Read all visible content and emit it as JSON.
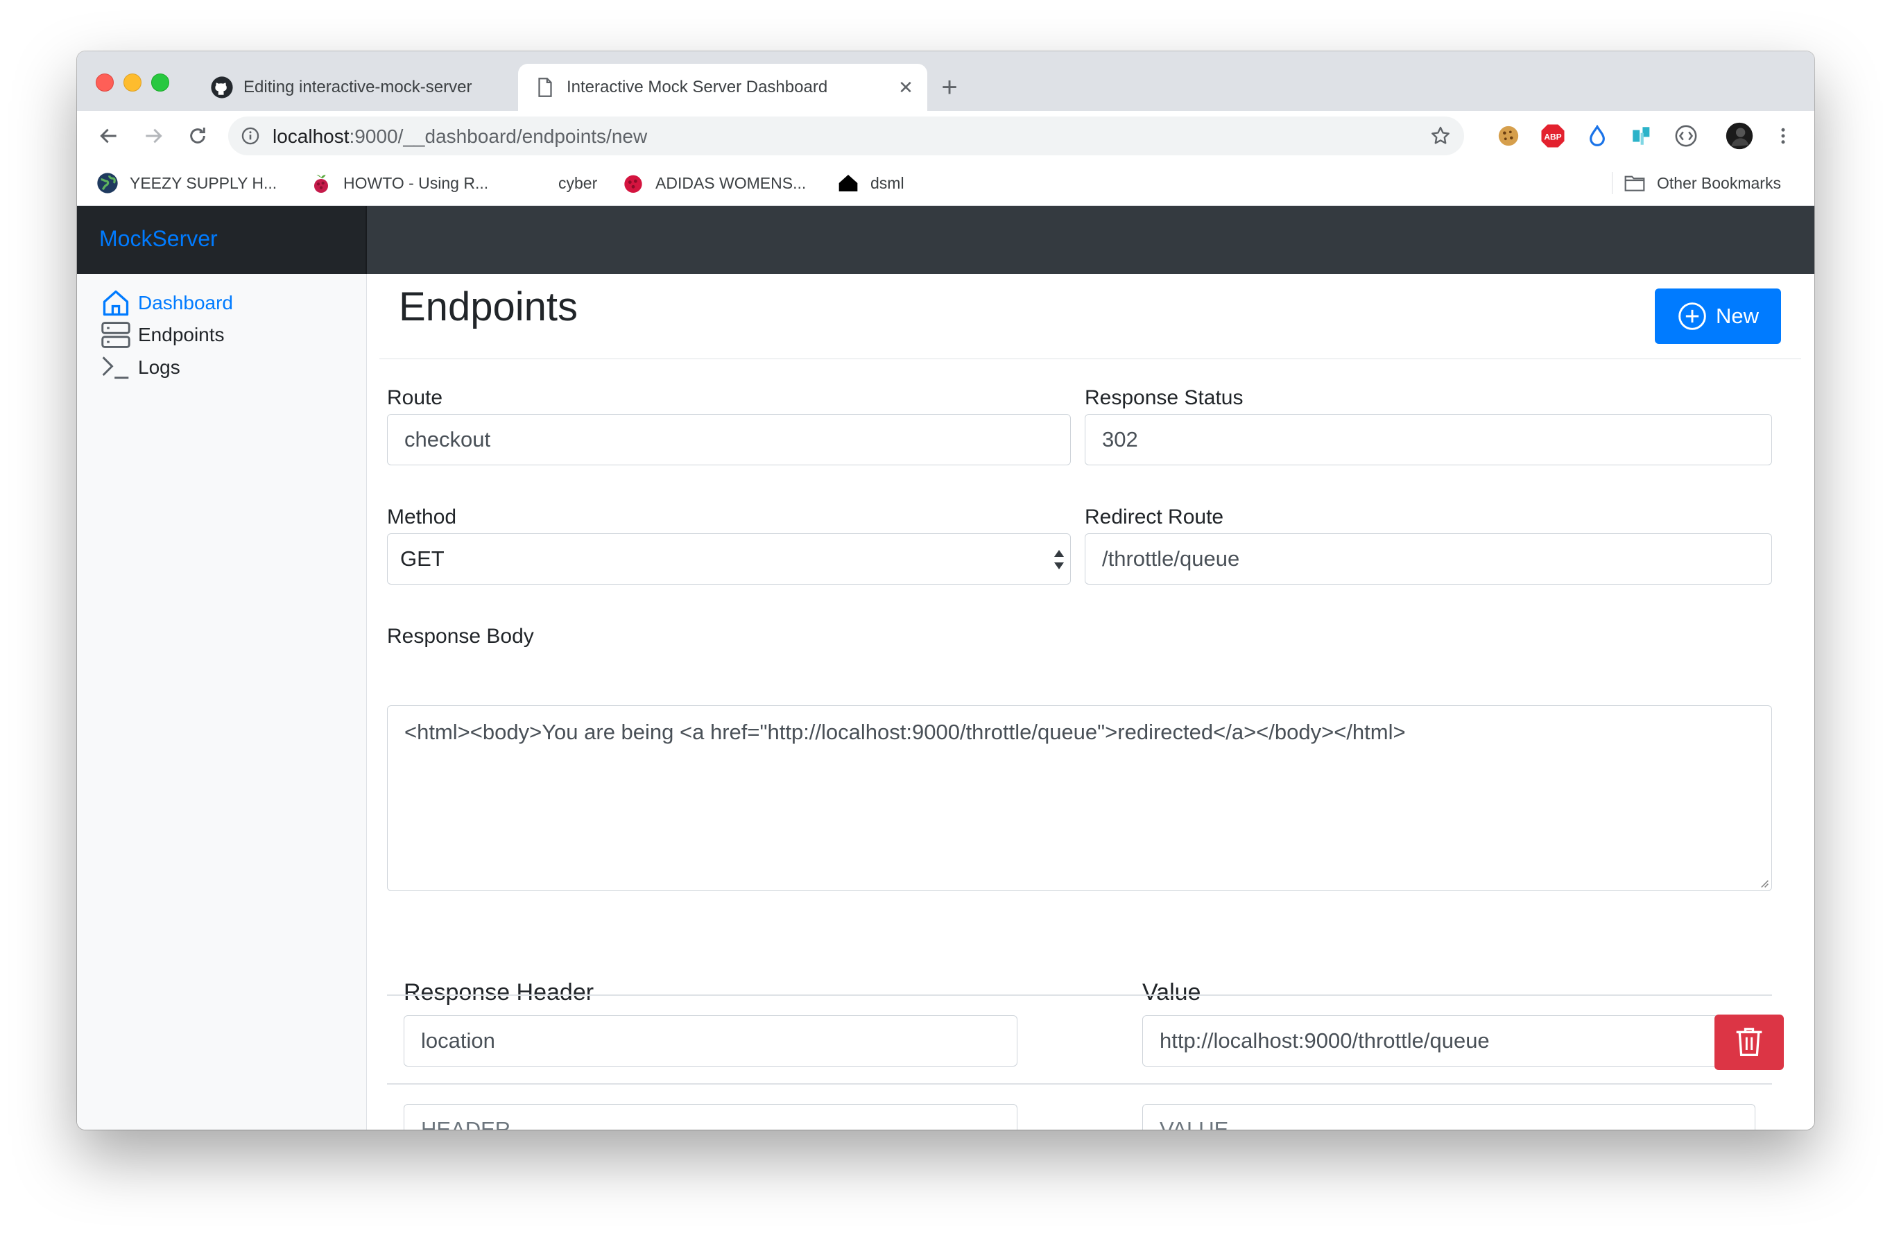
{
  "browser": {
    "tabs": [
      {
        "title": "Editing interactive-mock-server",
        "icon": "github-icon"
      },
      {
        "title": "Interactive Mock Server Dashboard",
        "icon": "page-icon"
      }
    ],
    "close_glyph": "✕",
    "new_tab_glyph": "+",
    "url_host": "localhost",
    "url_rest": ":9000/__dashboard/endpoints/new",
    "extensions": [
      "cookie-icon",
      "adblock-icon",
      "drop-icon",
      "ext-icon",
      "code-icon",
      "profile-avatar",
      "more-icon"
    ],
    "bookmarks": [
      {
        "label": "YEEZY SUPPLY H...",
        "icon": "globe-icon"
      },
      {
        "label": "HOWTO - Using R...",
        "icon": "raspberry-icon"
      },
      {
        "label": "cyber",
        "icon": ""
      },
      {
        "label": "ADIDAS WOMENS...",
        "icon": "raspberry-red-icon"
      },
      {
        "label": "dsml",
        "icon": "house-icon"
      }
    ],
    "other_bookmarks": "Other Bookmarks"
  },
  "app": {
    "brand": "MockServer",
    "sidebar": [
      {
        "label": "Dashboard",
        "icon": "home-icon",
        "active": true
      },
      {
        "label": "Endpoints",
        "icon": "server-icon",
        "active": false
      },
      {
        "label": "Logs",
        "icon": "terminal-icon",
        "active": false
      }
    ],
    "page_title": "Endpoints",
    "new_button": "New",
    "form": {
      "route_label": "Route",
      "route_value": "checkout",
      "status_label": "Response Status",
      "status_value": "302",
      "method_label": "Method",
      "method_value": "GET",
      "redirect_label": "Redirect Route",
      "redirect_value": "/throttle/queue",
      "body_label": "Response Body",
      "body_value": "<html><body>You are being <a href=\"http://localhost:9000/throttle/queue\">redirected</a></body></html>"
    },
    "headers_table": {
      "col_header": "Response Header",
      "col_value": "Value",
      "rows": [
        {
          "header": "location",
          "value": "http://localhost:9000/throttle/queue"
        }
      ],
      "new_row": {
        "header_placeholder": "HEADER",
        "value_placeholder": "VALUE"
      }
    }
  },
  "colors": {
    "primary": "#007bff",
    "danger": "#dc3545",
    "navbar": "#343a40",
    "brand_bg": "#212529",
    "sidebar_bg": "#f8f9fa"
  }
}
